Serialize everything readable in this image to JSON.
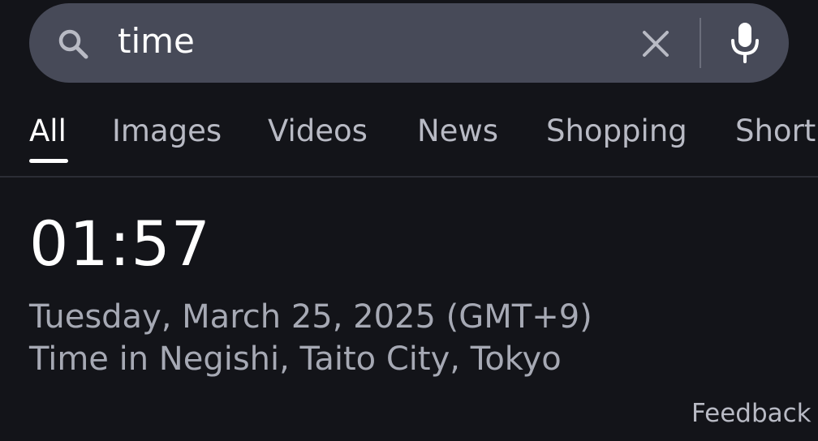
{
  "search": {
    "query": "time"
  },
  "tabs": [
    {
      "label": "All",
      "active": true
    },
    {
      "label": "Images",
      "active": false
    },
    {
      "label": "Videos",
      "active": false
    },
    {
      "label": "News",
      "active": false
    },
    {
      "label": "Shopping",
      "active": false
    },
    {
      "label": "Short",
      "active": false
    }
  ],
  "result": {
    "time": "01:57",
    "date": "Tuesday, March 25, 2025 (GMT+9)",
    "location": "Time in Negishi, Taito City, Tokyo"
  },
  "feedback_label": "Feedback",
  "icons": {
    "search": "search-icon",
    "clear": "close-icon",
    "mic": "microphone-icon"
  }
}
